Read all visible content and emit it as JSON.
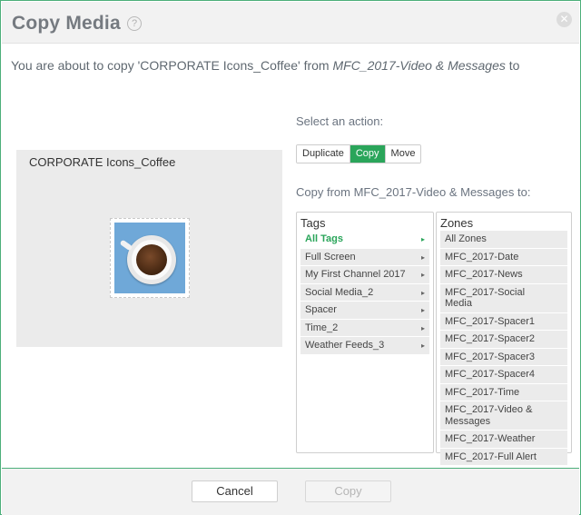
{
  "dialog": {
    "title": "Copy Media",
    "help_icon": "help-circle-icon",
    "help_glyph": "?",
    "close_icon": "close-icon",
    "close_glyph": "✕"
  },
  "subtitle": {
    "prefix": "You are about to copy 'CORPORATE Icons_Coffee' from ",
    "source": "MFC_2017-Video & Messages",
    "suffix": " to"
  },
  "preview": {
    "name": "CORPORATE Icons_Coffee",
    "thumbnail_icon": "coffee-cup-icon"
  },
  "action": {
    "label": "Select an action:",
    "options": [
      "Duplicate",
      "Copy",
      "Move"
    ],
    "selected": "Copy"
  },
  "destination_label": "Copy from MFC_2017-Video & Messages to:",
  "tags": {
    "title": "Tags",
    "items": [
      {
        "label": "All Tags",
        "selected": true
      },
      {
        "label": "Full Screen",
        "selected": false
      },
      {
        "label": "My First Channel 2017",
        "selected": false
      },
      {
        "label": "Social Media_2",
        "selected": false
      },
      {
        "label": "Spacer",
        "selected": false
      },
      {
        "label": "Time_2",
        "selected": false
      },
      {
        "label": "Weather Feeds_3",
        "selected": false
      }
    ],
    "chevron": "▸"
  },
  "zones": {
    "title": "Zones",
    "items": [
      "All Zones",
      "MFC_2017-Date",
      "MFC_2017-News",
      "MFC_2017-Social Media",
      "MFC_2017-Spacer1",
      "MFC_2017-Spacer2",
      "MFC_2017-Spacer3",
      "MFC_2017-Spacer4",
      "MFC_2017-Time",
      "MFC_2017-Video & Messages",
      "MFC_2017-Weather",
      "MFC_2017-Full Alert"
    ]
  },
  "footer": {
    "cancel_label": "Cancel",
    "copy_label": "Copy"
  },
  "colors": {
    "accent": "#2aa55a",
    "border_accent": "#4caf7a"
  }
}
